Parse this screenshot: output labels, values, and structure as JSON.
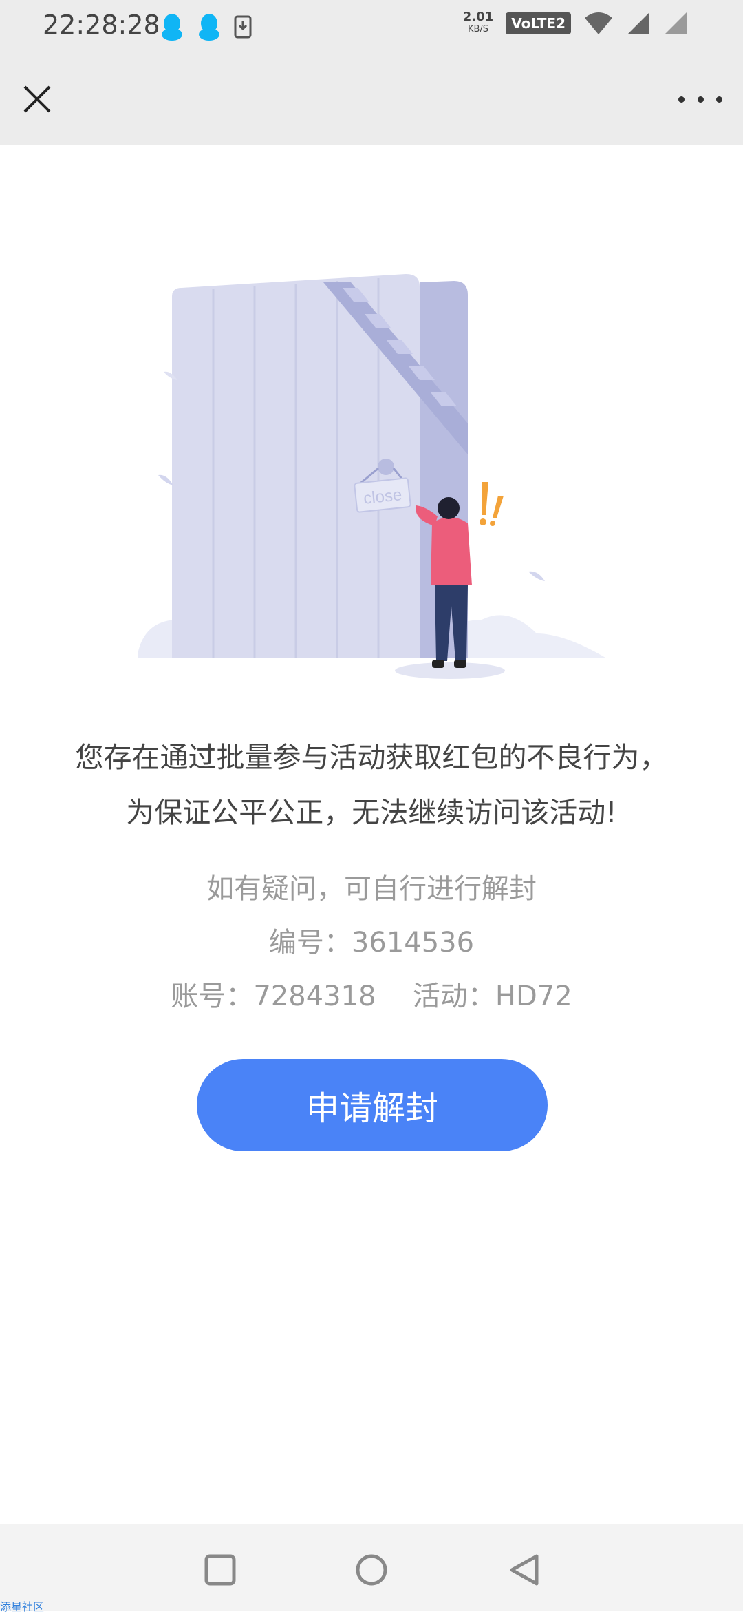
{
  "status_bar": {
    "time": "22:28:28",
    "net_speed_value": "2.01",
    "net_speed_unit": "KB/S",
    "network_label": "VoLTE2",
    "icons": [
      "qq-icon",
      "qq-icon",
      "download-icon",
      "wifi-icon",
      "signal-icon",
      "signal-icon"
    ]
  },
  "top_bar": {
    "close_icon": "close-icon",
    "more_icon": "more-icon"
  },
  "illustration": {
    "sign_text": "close"
  },
  "message": {
    "line1": "您存在通过批量参与活动获取红包的不良行为，",
    "line2": "为保证公平公正，无法继续访问该活动!"
  },
  "info": {
    "hint": "如有疑问，可自行进行解封",
    "serial_label": "编号：",
    "serial_value": "3614536",
    "account_label": "账号：",
    "account_value": "7284318",
    "activity_label": "活动：",
    "activity_value": "HD72"
  },
  "actions": {
    "unlock_label": "申请解封"
  },
  "nav_bar": {
    "icons": [
      "recent-apps-icon",
      "home-icon",
      "back-icon"
    ]
  },
  "watermark": "添星社区",
  "colors": {
    "primary_button": "#4a83f7",
    "bar_background": "#ececec",
    "text_main": "#444444",
    "text_muted": "#9a9a9a"
  }
}
